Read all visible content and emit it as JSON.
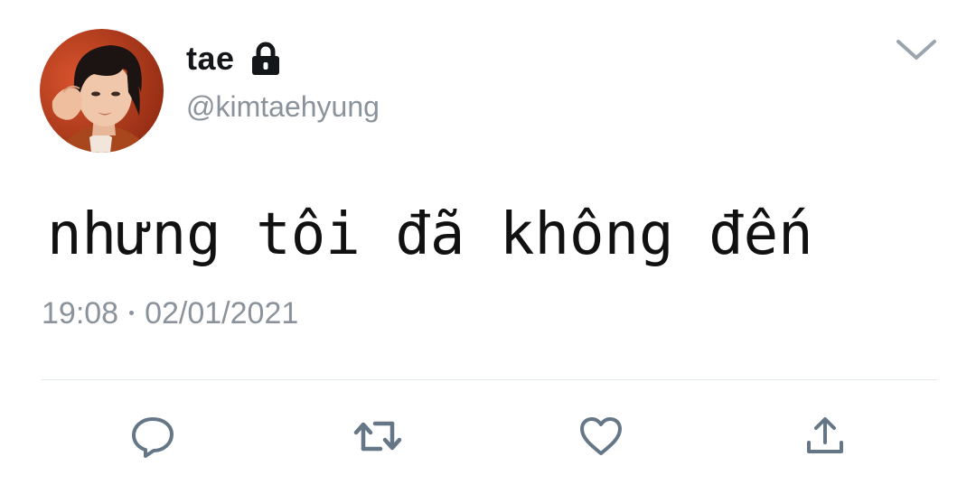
{
  "tweet": {
    "display_name": "tae",
    "handle": "@kimtaehyung",
    "text": "nhưng tôi đã không đến",
    "time": "19:08",
    "date": "02/01/2021"
  },
  "icons": {
    "lock": "lock-icon",
    "menu": "chevron-down-icon",
    "reply": "reply-icon",
    "retweet": "retweet-icon",
    "like": "heart-icon",
    "share": "share-icon"
  },
  "colors": {
    "text_primary": "#14171a",
    "text_secondary": "#8a939b",
    "icon": "#657786",
    "divider": "#e1e8ed"
  }
}
